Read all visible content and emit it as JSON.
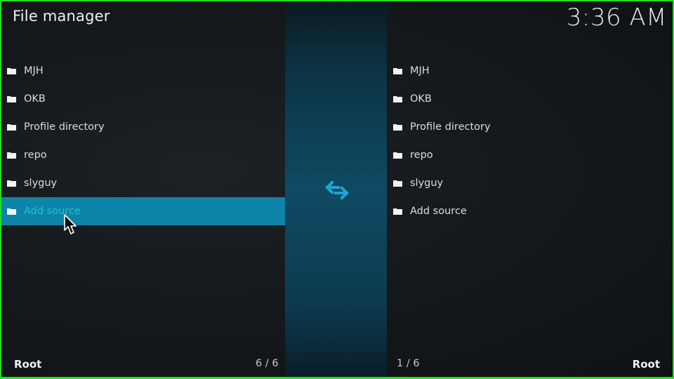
{
  "header": {
    "title": "File manager",
    "clock": "3:36 AM"
  },
  "left_pane": {
    "items": [
      {
        "label": "MJH",
        "icon": "folder-icon"
      },
      {
        "label": "OKB",
        "icon": "folder-icon"
      },
      {
        "label": "Profile directory",
        "icon": "folder-icon"
      },
      {
        "label": "repo",
        "icon": "folder-icon"
      },
      {
        "label": "slyguy",
        "icon": "folder-icon"
      },
      {
        "label": "Add source",
        "icon": "folder-icon",
        "focused": true
      }
    ],
    "path": "Root",
    "position": "6 / 6"
  },
  "right_pane": {
    "items": [
      {
        "label": "MJH",
        "icon": "folder-icon"
      },
      {
        "label": "OKB",
        "icon": "folder-icon"
      },
      {
        "label": "Profile directory",
        "icon": "folder-icon"
      },
      {
        "label": "repo",
        "icon": "folder-icon"
      },
      {
        "label": "slyguy",
        "icon": "folder-icon"
      },
      {
        "label": "Add source",
        "icon": "folder-icon"
      }
    ],
    "path": "Root",
    "position": "1 / 6"
  },
  "center": {
    "icon": "swap-arrows-icon"
  },
  "colors": {
    "focus_background": "#0d84a8",
    "focus_text": "#18c7c9",
    "accent_icon": "#1fa5d6"
  }
}
